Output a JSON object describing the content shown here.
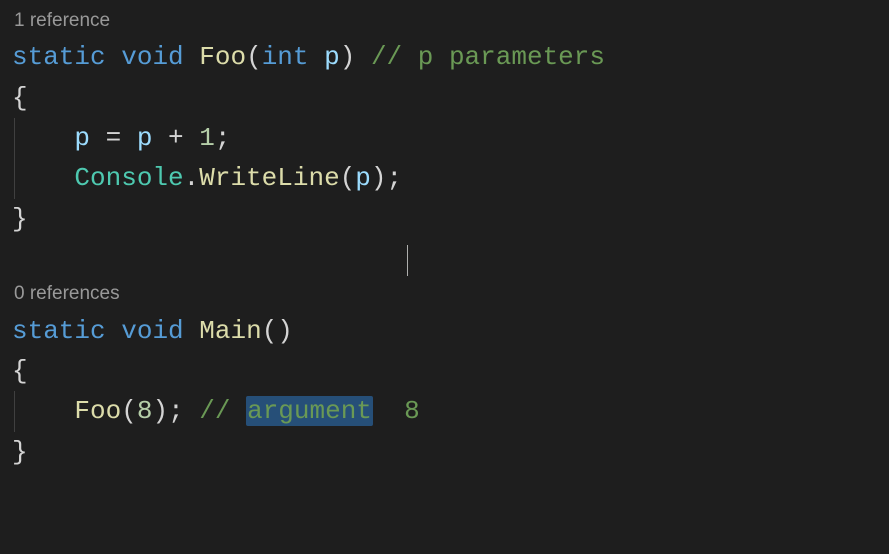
{
  "method1": {
    "codelens": "1 reference",
    "kw_static": "static",
    "kw_void": "void",
    "name": "Foo",
    "open_paren": "(",
    "param_type": "int",
    "param_name": "p",
    "close_paren": ")",
    "comment": "// p parameters",
    "brace_open": "{",
    "body_line1": {
      "indent": "    ",
      "lhs": "p",
      "op": " = ",
      "rhs1": "p",
      "op2": " + ",
      "num": "1",
      "semi": ";"
    },
    "body_line2": {
      "indent": "    ",
      "class": "Console",
      "dot": ".",
      "method": "WriteLine",
      "open": "(",
      "arg": "p",
      "close": ")",
      "semi": ";"
    },
    "brace_close": "}"
  },
  "method2": {
    "codelens": "0 references",
    "kw_static": "static",
    "kw_void": "void",
    "name": "Main",
    "parens": "()",
    "brace_open": "{",
    "body_line1": {
      "indent": "    ",
      "method": "Foo",
      "open": "(",
      "arg": "8",
      "close": ")",
      "semi": ";",
      "sp": " ",
      "comment_slashes": "// ",
      "highlight_word": "argument",
      "comment_rest": "  8"
    },
    "brace_close": "}"
  }
}
